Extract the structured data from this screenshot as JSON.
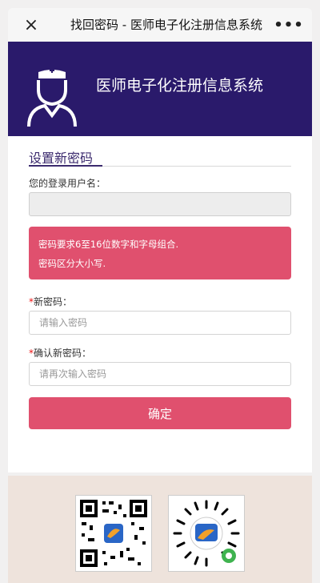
{
  "nav": {
    "close_icon": "×",
    "title": "找回密码 - 医师电子化注册信息系统",
    "more_icon": "•••"
  },
  "banner": {
    "title": "医师电子化注册信息系统",
    "icon": "doctor-icon"
  },
  "form": {
    "section_title": "设置新密码",
    "username_label": "您的登录用户名：",
    "username_value": "",
    "alert_lines": [
      "密码要求6至16位数字和字母组合.",
      "密码区分大小写."
    ],
    "new_password_label": "新密码：",
    "new_password_placeholder": "请输入密码",
    "confirm_password_label": "确认新密码：",
    "confirm_password_placeholder": "请再次输入密码",
    "required_mark": "*",
    "submit_label": "确定"
  },
  "footer": {
    "qr_codes": [
      "qr-code",
      "mini-program-code"
    ]
  },
  "colors": {
    "banner": "#2a1a6b",
    "accent": "#e0506e",
    "section_title": "#3b2a6e",
    "footer": "#eee3dc"
  }
}
